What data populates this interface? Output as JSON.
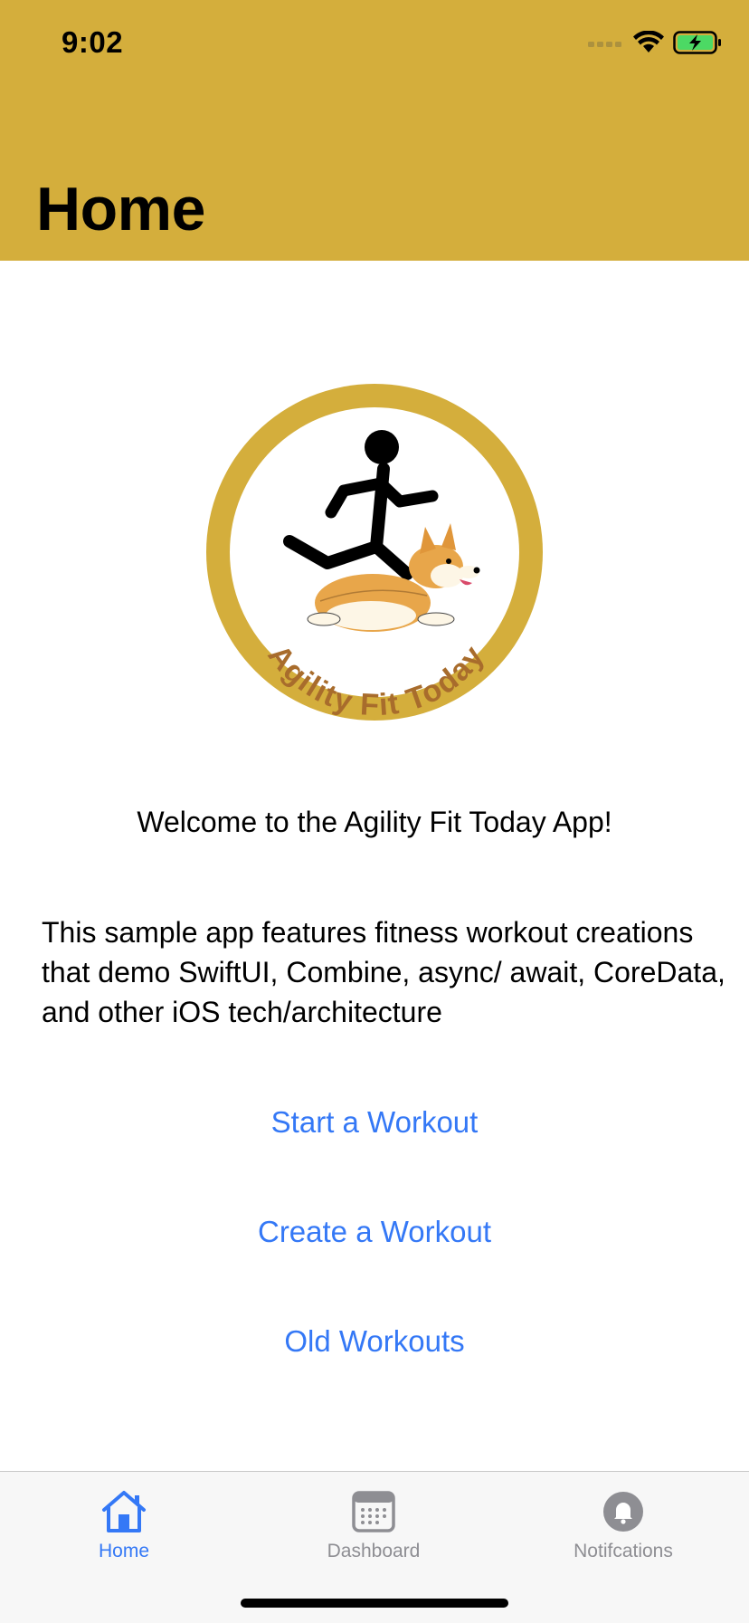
{
  "colors": {
    "header_bg": "#d4ae3c",
    "link": "#3478f6",
    "tab_inactive": "#8e8e93",
    "battery_fill": "#4cd964"
  },
  "status_bar": {
    "time": "9:02",
    "icons": [
      "cellular-signal-icon",
      "wifi-icon",
      "battery-charging-icon"
    ]
  },
  "header": {
    "title": "Home"
  },
  "logo": {
    "text": "Agility Fit Today",
    "icons": [
      "running-stick-figure-icon",
      "corgi-dog-icon"
    ]
  },
  "main": {
    "welcome": "Welcome to the Agility Fit Today App!",
    "description": "This sample app features fitness workout creations that demo SwiftUI, Combine, async/ await, CoreData, and other iOS tech/architecture",
    "actions": [
      {
        "label": "Start a Workout"
      },
      {
        "label": "Create a Workout"
      },
      {
        "label": "Old Workouts"
      }
    ]
  },
  "tabbar": {
    "tabs": [
      {
        "label": "Home",
        "icon": "house-icon",
        "selected": true
      },
      {
        "label": "Dashboard",
        "icon": "calendar-icon",
        "selected": false
      },
      {
        "label": "Notifcations",
        "icon": "bell-icon",
        "selected": false
      }
    ]
  }
}
